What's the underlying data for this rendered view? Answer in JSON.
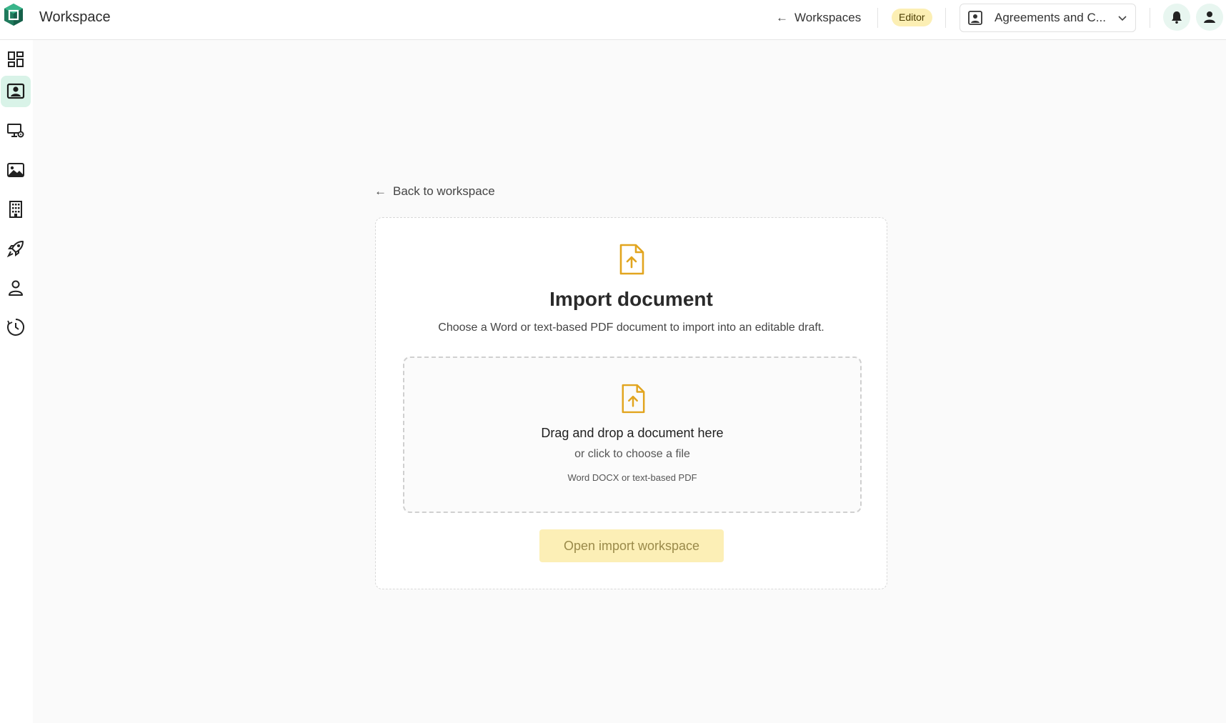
{
  "header": {
    "app_title": "Workspace",
    "back_label": "Workspaces",
    "role_badge": "Editor",
    "workspace_selector": "Agreements and C...",
    "icons": [
      "logo-icon",
      "arrow-left-icon",
      "workspace-icon",
      "chevron-down-icon",
      "bell-icon",
      "user-icon"
    ]
  },
  "sidebar": {
    "items": [
      {
        "name": "dashboard",
        "icon": "dashboard-icon"
      },
      {
        "name": "workspace",
        "icon": "portrait-icon",
        "active": true
      },
      {
        "name": "monitor-settings",
        "icon": "monitor-gear-icon"
      },
      {
        "name": "images",
        "icon": "image-icon"
      },
      {
        "name": "organization",
        "icon": "building-icon"
      },
      {
        "name": "launch",
        "icon": "rocket-icon"
      },
      {
        "name": "users",
        "icon": "person-icon"
      },
      {
        "name": "history",
        "icon": "clock-icon"
      }
    ]
  },
  "main": {
    "back_link": "Back to workspace",
    "card": {
      "title": "Import document",
      "subtitle": "Choose a Word or text-based PDF document to import into an editable draft.",
      "dropzone": {
        "title": "Drag and drop a document here",
        "subtitle": "or click to choose a file",
        "hint": "Word DOCX or text-based PDF"
      },
      "button_label": "Open import workspace"
    }
  },
  "colors": {
    "accent": "#e2a51f",
    "active_nav_bg": "#d9f3e8",
    "badge_bg": "#fcefb4",
    "button_bg": "#fcefb6",
    "button_text": "#9a8a4a"
  }
}
